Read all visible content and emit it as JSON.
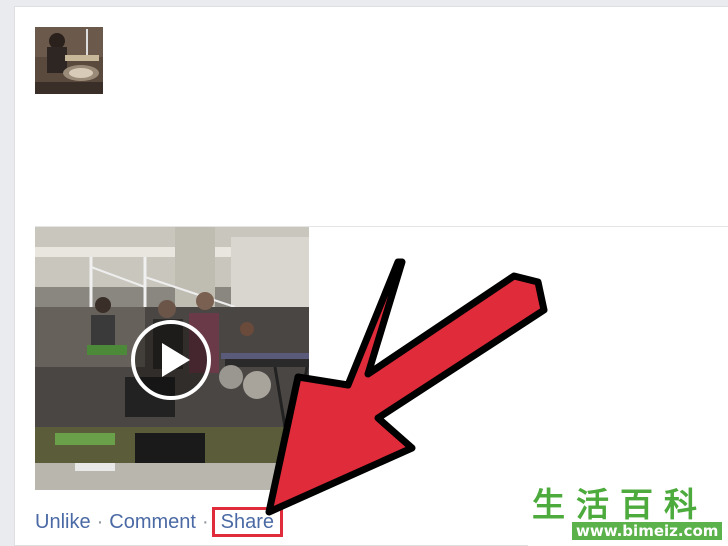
{
  "post": {
    "actions": {
      "unlike": "Unlike",
      "comment": "Comment",
      "share": "Share",
      "separator": "·"
    }
  },
  "overlay": {
    "arrow_color": "#e02b3b",
    "highlight_color": "#e02b3b"
  },
  "watermark": {
    "title": "生活百科",
    "url": "www.bimeiz.com"
  },
  "icons": {
    "play": "play-icon"
  }
}
